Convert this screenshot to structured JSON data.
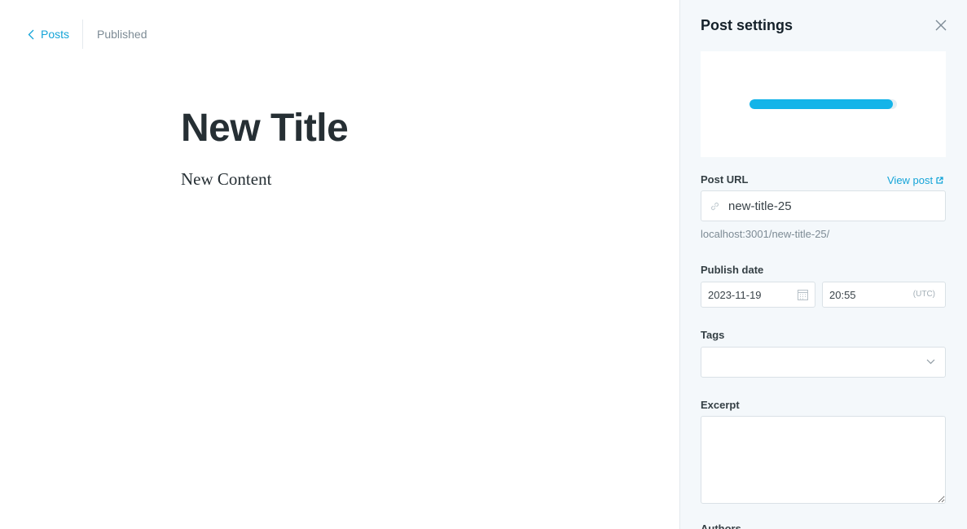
{
  "header": {
    "back_label": "Posts",
    "status": "Published"
  },
  "post": {
    "title": "New Title",
    "content": "New Content"
  },
  "settings": {
    "title": "Post settings",
    "image_upload_progress": 0.97,
    "post_url_label": "Post URL",
    "view_post_label": "View post",
    "slug": "new-title-25",
    "url_hint": "localhost:3001/new-title-25/",
    "publish_date_label": "Publish date",
    "date": "2023-11-19",
    "time": "20:55",
    "timezone": "(UTC)",
    "tags_label": "Tags",
    "excerpt_label": "Excerpt",
    "authors_label": "Authors"
  },
  "colors": {
    "accent": "#14a4d8",
    "progress": "#14b4e9",
    "panel_bg": "#f4f8fb"
  }
}
